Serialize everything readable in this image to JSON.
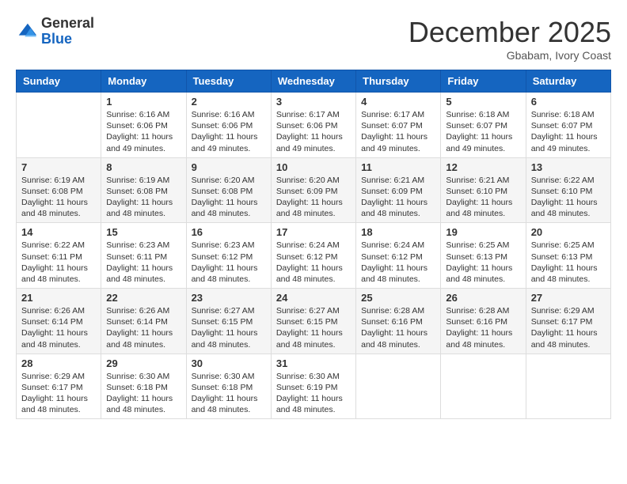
{
  "header": {
    "logo": {
      "general": "General",
      "blue": "Blue"
    },
    "title": "December 2025",
    "subtitle": "Gbabam, Ivory Coast"
  },
  "weekdays": [
    "Sunday",
    "Monday",
    "Tuesday",
    "Wednesday",
    "Thursday",
    "Friday",
    "Saturday"
  ],
  "weeks": [
    [
      null,
      {
        "day": 1,
        "sunrise": "6:16 AM",
        "sunset": "6:06 PM",
        "daylight": "11 hours and 49 minutes."
      },
      {
        "day": 2,
        "sunrise": "6:16 AM",
        "sunset": "6:06 PM",
        "daylight": "11 hours and 49 minutes."
      },
      {
        "day": 3,
        "sunrise": "6:17 AM",
        "sunset": "6:06 PM",
        "daylight": "11 hours and 49 minutes."
      },
      {
        "day": 4,
        "sunrise": "6:17 AM",
        "sunset": "6:07 PM",
        "daylight": "11 hours and 49 minutes."
      },
      {
        "day": 5,
        "sunrise": "6:18 AM",
        "sunset": "6:07 PM",
        "daylight": "11 hours and 49 minutes."
      },
      {
        "day": 6,
        "sunrise": "6:18 AM",
        "sunset": "6:07 PM",
        "daylight": "11 hours and 49 minutes."
      }
    ],
    [
      {
        "day": 7,
        "sunrise": "6:19 AM",
        "sunset": "6:08 PM",
        "daylight": "11 hours and 48 minutes."
      },
      {
        "day": 8,
        "sunrise": "6:19 AM",
        "sunset": "6:08 PM",
        "daylight": "11 hours and 48 minutes."
      },
      {
        "day": 9,
        "sunrise": "6:20 AM",
        "sunset": "6:08 PM",
        "daylight": "11 hours and 48 minutes."
      },
      {
        "day": 10,
        "sunrise": "6:20 AM",
        "sunset": "6:09 PM",
        "daylight": "11 hours and 48 minutes."
      },
      {
        "day": 11,
        "sunrise": "6:21 AM",
        "sunset": "6:09 PM",
        "daylight": "11 hours and 48 minutes."
      },
      {
        "day": 12,
        "sunrise": "6:21 AM",
        "sunset": "6:10 PM",
        "daylight": "11 hours and 48 minutes."
      },
      {
        "day": 13,
        "sunrise": "6:22 AM",
        "sunset": "6:10 PM",
        "daylight": "11 hours and 48 minutes."
      }
    ],
    [
      {
        "day": 14,
        "sunrise": "6:22 AM",
        "sunset": "6:11 PM",
        "daylight": "11 hours and 48 minutes."
      },
      {
        "day": 15,
        "sunrise": "6:23 AM",
        "sunset": "6:11 PM",
        "daylight": "11 hours and 48 minutes."
      },
      {
        "day": 16,
        "sunrise": "6:23 AM",
        "sunset": "6:12 PM",
        "daylight": "11 hours and 48 minutes."
      },
      {
        "day": 17,
        "sunrise": "6:24 AM",
        "sunset": "6:12 PM",
        "daylight": "11 hours and 48 minutes."
      },
      {
        "day": 18,
        "sunrise": "6:24 AM",
        "sunset": "6:12 PM",
        "daylight": "11 hours and 48 minutes."
      },
      {
        "day": 19,
        "sunrise": "6:25 AM",
        "sunset": "6:13 PM",
        "daylight": "11 hours and 48 minutes."
      },
      {
        "day": 20,
        "sunrise": "6:25 AM",
        "sunset": "6:13 PM",
        "daylight": "11 hours and 48 minutes."
      }
    ],
    [
      {
        "day": 21,
        "sunrise": "6:26 AM",
        "sunset": "6:14 PM",
        "daylight": "11 hours and 48 minutes."
      },
      {
        "day": 22,
        "sunrise": "6:26 AM",
        "sunset": "6:14 PM",
        "daylight": "11 hours and 48 minutes."
      },
      {
        "day": 23,
        "sunrise": "6:27 AM",
        "sunset": "6:15 PM",
        "daylight": "11 hours and 48 minutes."
      },
      {
        "day": 24,
        "sunrise": "6:27 AM",
        "sunset": "6:15 PM",
        "daylight": "11 hours and 48 minutes."
      },
      {
        "day": 25,
        "sunrise": "6:28 AM",
        "sunset": "6:16 PM",
        "daylight": "11 hours and 48 minutes."
      },
      {
        "day": 26,
        "sunrise": "6:28 AM",
        "sunset": "6:16 PM",
        "daylight": "11 hours and 48 minutes."
      },
      {
        "day": 27,
        "sunrise": "6:29 AM",
        "sunset": "6:17 PM",
        "daylight": "11 hours and 48 minutes."
      }
    ],
    [
      {
        "day": 28,
        "sunrise": "6:29 AM",
        "sunset": "6:17 PM",
        "daylight": "11 hours and 48 minutes."
      },
      {
        "day": 29,
        "sunrise": "6:30 AM",
        "sunset": "6:18 PM",
        "daylight": "11 hours and 48 minutes."
      },
      {
        "day": 30,
        "sunrise": "6:30 AM",
        "sunset": "6:18 PM",
        "daylight": "11 hours and 48 minutes."
      },
      {
        "day": 31,
        "sunrise": "6:30 AM",
        "sunset": "6:19 PM",
        "daylight": "11 hours and 48 minutes."
      },
      null,
      null,
      null
    ]
  ]
}
